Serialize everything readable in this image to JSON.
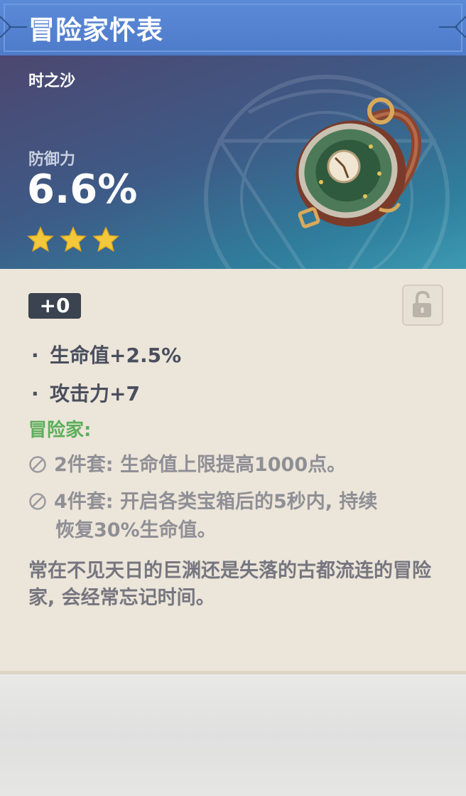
{
  "title": "冒险家怀表",
  "slot_type": "时之沙",
  "main_stat": {
    "label": "防御力",
    "value": "6.6%"
  },
  "rarity_stars": 3,
  "level": "+0",
  "lock_state": "unlocked",
  "substats": [
    {
      "bullet": "·",
      "text": "生命值+2.5%"
    },
    {
      "bullet": "·",
      "text": "攻击力+7"
    }
  ],
  "set": {
    "name": "冒险家:",
    "effects": [
      {
        "line1": "2件套: 生命值上限提高1000点。",
        "line2": ""
      },
      {
        "line1": "4件套: 开启各类宝箱后的5秒内, 持续",
        "line2": "恢复30%生命值。"
      }
    ]
  },
  "description": "常在不见天日的巨渊还是失落的古都流连的冒险家, 会经常忘记时间。",
  "colors": {
    "title_bar": "#5b8ad8",
    "set_name": "#5cae5a",
    "star": "#f3c83a",
    "level_badge": "#3a434f"
  },
  "icons": {
    "star": "star-icon",
    "lock": "unlocked-padlock-icon",
    "inactive": "prohibited-circle-icon",
    "artifact": "pocket-watch-icon"
  }
}
